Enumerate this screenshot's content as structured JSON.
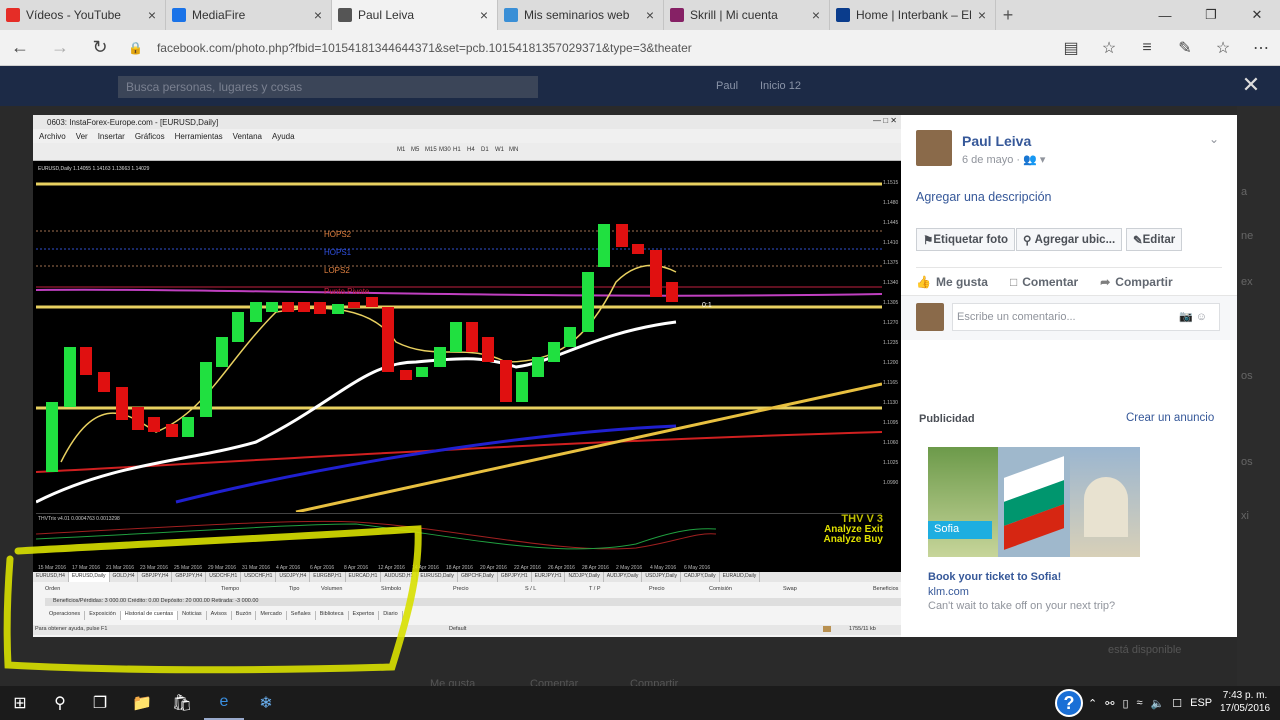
{
  "browser": {
    "tabs": [
      {
        "label": "Vídeos - YouTube",
        "icon": "youtube-icon",
        "color": "#e52d27"
      },
      {
        "label": "MediaFire",
        "icon": "mediafire-icon",
        "color": "#1a73e8"
      },
      {
        "label": "Paul Leiva",
        "icon": "page-icon",
        "color": "#555555"
      },
      {
        "label": "Mis seminarios web",
        "icon": "webinar-icon",
        "color": "#3a8fd6"
      },
      {
        "label": "Skrill | Mi cuenta",
        "icon": "skrill-icon",
        "color": "#862165"
      },
      {
        "label": "Home | Interbank – El tiemp",
        "icon": "interbank-icon",
        "color": "#0a3c8c"
      }
    ],
    "url": "facebook.com/photo.php?fbid=10154181344644371&set=pcb.10154181357029371&type=3&theater"
  },
  "fb_header": {
    "search_placeholder": "Busca personas, lugares y cosas",
    "user": "Paul",
    "home": "Inicio",
    "home_count": "12"
  },
  "mt4": {
    "title": "0603: InstaForex-Europe.com - [EURUSD,Daily]",
    "menu": [
      "Archivo",
      "Ver",
      "Insertar",
      "Gráficos",
      "Herramientas",
      "Ventana",
      "Ayuda"
    ],
    "timeframes": [
      "M1",
      "M5",
      "M15",
      "M30",
      "H1",
      "H4",
      "D1",
      "W1",
      "MN"
    ],
    "chart_label": "EURUSD,Daily  1.14055 1.14163 1.13663 1.14029",
    "levels": [
      "HOPS2",
      "HOPS1",
      "LOPS2",
      "Punto Pivote"
    ],
    "ratio_label": "0:1",
    "indicator_label": "THVTrix v4.01 0.0004763 0.0013298",
    "thv_title": "THV V 3",
    "analyze_exit": "Analyze Exit",
    "analyze_buy": "Analyze Buy",
    "price_ticks": [
      "1.1515",
      "1.1480",
      "1.1445",
      "1.1410",
      "1.1375",
      "1.1340",
      "1.1305",
      "1.1270",
      "1.1235",
      "1.1200",
      "1.1165",
      "1.1130",
      "1.1095",
      "1.1060",
      "1.1025",
      "1.0990"
    ],
    "dates": [
      "15 Mar 2016",
      "17 Mar 2016",
      "21 Mar 2016",
      "23 Mar 2016",
      "25 Mar 2016",
      "29 Mar 2016",
      "31 Mar 2016",
      "4 Apr 2016",
      "6 Apr 2016",
      "8 Apr 2016",
      "12 Apr 2016",
      "14 Apr 2016",
      "18 Apr 2016",
      "20 Apr 2016",
      "22 Apr 2016",
      "26 Apr 2016",
      "28 Apr 2016",
      "2 May 2016",
      "4 May 2016",
      "6 May 2016"
    ],
    "symbol_tabs": [
      "EURUSD,H4",
      "EURUSD,Daily",
      "GOLD,H4",
      "GBPJPY,H4",
      "GBPJPY,H4",
      "USDCHF,H1",
      "USDCHF,H1",
      "USDJPY,H4",
      "EURGBP,H1",
      "EURCAD,H1",
      "AUDUSD,H1",
      "EURUSD,Daily",
      "GBPCHF,Daily",
      "GBPJPY,H1",
      "EURJPY,H1",
      "NZDJPY,Daily",
      "AUDJPY,Daily",
      "USDJPY,Daily",
      "CADJPY,Daily",
      "EURAUD,Daily"
    ],
    "terminal_headers": [
      "Orden",
      "Tiempo",
      "Tipo",
      "Volumen",
      "Símbolo",
      "Precio",
      "S / L",
      "T / P",
      "Precio",
      "Comisión",
      "Swap",
      "Beneficios"
    ],
    "balance": "Beneficios/Pérdidas: 3 000.00  Crédito: 0.00  Depósito: 20 000.00  Retirada: -3 000.00",
    "bottom_tabs": [
      "Operaciones",
      "Exposición",
      "Historial de cuentas",
      "Noticias",
      "Avisos",
      "Buzón",
      "Mercado",
      "Señales",
      "Biblioteca",
      "Expertos",
      "Diario"
    ],
    "status_help": "Para obtener ayuda, pulse F1",
    "status_profile": "Default",
    "status_kb": "1755/11 kb"
  },
  "panel": {
    "name": "Paul Leiva",
    "date": "6 de mayo",
    "add_description": "Agregar una descripción",
    "tag_photo": "Etiquetar foto",
    "add_location": "Agregar ubic...",
    "edit": "Editar",
    "like": "Me gusta",
    "comment": "Comentar",
    "share": "Compartir",
    "comment_placeholder": "Escribe un comentario...",
    "sponsored": "Publicidad",
    "create_ad": "Crear un anuncio",
    "ad_image_text": "Sofia",
    "ad_title": "Book your ticket to Sofia!",
    "ad_url": "klm.com",
    "ad_desc": "Can't wait to take off on your next trip?"
  },
  "background_text": {
    "right_labels": [
      "a",
      "ne",
      "ex",
      "os",
      "os",
      "xi"
    ],
    "bottom_items": [
      "Me gusta",
      "Comentar",
      "Compartir"
    ],
    "available": "está disponible"
  },
  "taskbar": {
    "lang": "ESP",
    "time": "7:43 p. m.",
    "date": "17/05/2016"
  }
}
